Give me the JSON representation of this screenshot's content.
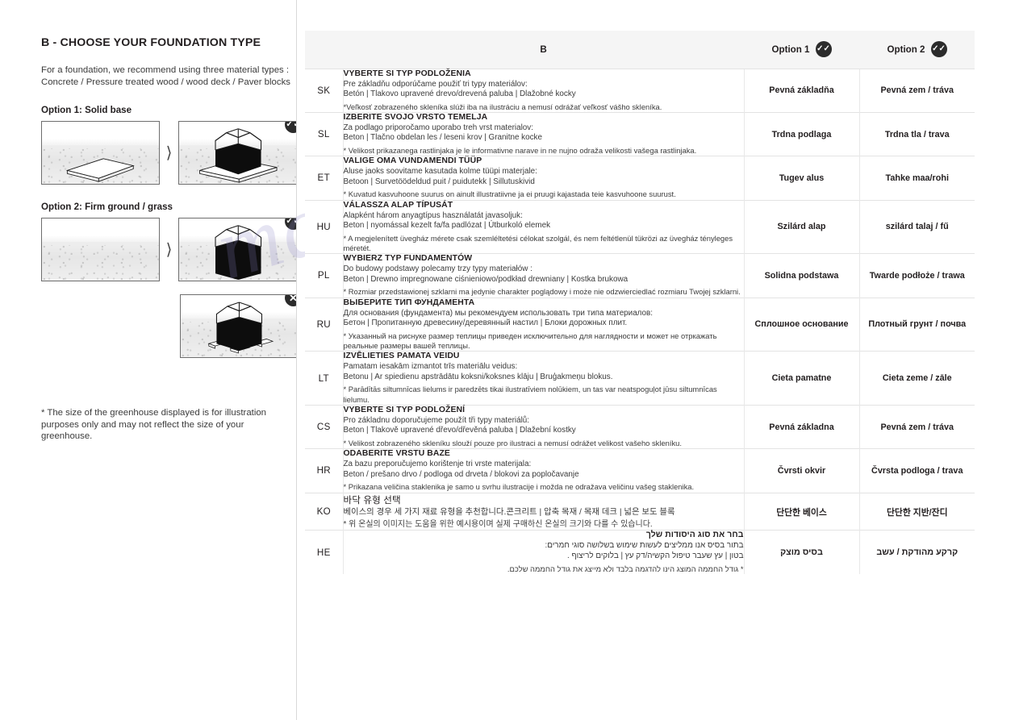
{
  "left": {
    "section_title": "B -  CHOOSE YOUR FOUNDATION TYPE",
    "intro_line1": "For a foundation, we recommend using three material types :",
    "intro_line2": "Concrete / Pressure treated wood / wood deck / Paver blocks",
    "option1_label": "Option 1: Solid base",
    "option2_label": "Option 2: Firm ground / grass",
    "arrow_glyph": "⟩",
    "badge_tick": "✓✓",
    "badge_cross": "✕",
    "footnote": "* The size of the greenhouse displayed is for illustration purposes only and may not reflect the size of your greenhouse."
  },
  "watermark": {
    "line1": "manualshive.com"
  },
  "table": {
    "header": {
      "lang": "",
      "body": "B",
      "option1": "Option 1",
      "option2": "Option 2",
      "badge": "✓✓"
    },
    "rows": [
      {
        "lang": "SK",
        "title": "VYBERTE SI TYP PODLOŽENIA",
        "line1": "Pre základňu odporúčame použiť tri typy materiálov:",
        "line2": "Betón | Tlakovo upravené drevo/drevená paluba | Dlažobné kocky",
        "note": "*Veľkosť zobrazeného skleníka slúži iba na ilustráciu a nemusí odrážať veľkosť vášho skleníka.",
        "option1": "Pevná základňa",
        "option2": "Pevná zem / tráva"
      },
      {
        "lang": "SL",
        "title": "IZBERITE SVOJO VRSTO TEMELJA",
        "line1": "Za podlago priporočamo uporabo treh vrst materialov:",
        "line2": "Beton |  Tlačno obdelan les / leseni krov  |  Granitne kocke",
        "note": "* Velikost prikazanega rastlinjaka je le informativne narave in ne nujno odraža velikosti vašega rastlinjaka.",
        "option1": "Trdna podlaga",
        "option2": "Trdna tla / trava"
      },
      {
        "lang": "ET",
        "title": "VALIGE OMA VUNDAMENDI TÜÜP",
        "line1": "Aluse jaoks soovitame kasutada kolme tüüpi materjale:",
        "line2": "Betoon | Survetöödeldud puit / puidutekk | Sillutuskivid",
        "note": "* Kuvatud kasvuhoone suurus on ainult illustratiivne ja ei pruugi kajastada teie kasvuhoone suurust.",
        "option1": "Tugev alus",
        "option2": "Tahke maa/rohi"
      },
      {
        "lang": "HU",
        "title": "VÁLASSZA ALAP TÍPUSÁT",
        "line1": "Alapként három anyagtípus használatát javasoljuk:",
        "line2": "Beton | nyomással kezelt fa/fa padlózat | Útburkoló elemek",
        "note": "* A megjelenített üvegház mérete csak szemléltetési célokat szolgál, és nem feltétlenül tükrözi az üvegház tényleges méretét.",
        "option1": "Szilárd alap",
        "option2": "szilárd talaj / fű"
      },
      {
        "lang": "PL",
        "title": "WYBIERZ TYP FUNDAMENTÓW",
        "line1": "Do budowy podstawy polecamy trzy typy materiałów :",
        "line2": "Beton |  Drewno impregnowane ciśnieniowo/podkład drewniany  |  Kostka brukowa",
        "note": "* Rozmiar przedstawionej szklarni ma jedynie charakter poglądowy i może nie odzwierciedlać rozmiaru Twojej szklarni.",
        "option1": "Solidna podstawa",
        "option2": "Twarde podłoże / trawa"
      },
      {
        "lang": "RU",
        "title": "ВЫБЕРИТЕ ТИП ФУНДАМЕНТА",
        "line1": "Для основания (фундамента) мы рекомендуем использовать три типа материалов:",
        "line2": "Бетон | Пропитанную древесину/деревянный настил | Блоки дорожных плит.",
        "note": "* Указанный на риснуке размер теплицы приведен исключительно для наглядности и может не отркажать реальные размеры вашей теплицы.",
        "option1": "Сплошное основание",
        "option2": "Плотный грунт / почва"
      },
      {
        "lang": "LT",
        "title": "IZVĒLIETIES PAMATA VEIDU",
        "line1": "Pamatam iesakām izmantot trīs materiālu veidus:",
        "line2": "Betonu | Ar spiedienu apstrādātu koksni/koksnes klāju | Bruģakmeņu blokus.",
        "note": "* Parādītās siltumnīcas lielums ir paredzēts tikai ilustratīviem nolūkiem, un tas var neatspoguļot jūsu siltumnīcas lielumu.",
        "option1": "Cieta pamatne",
        "option2": "Cieta zeme / zāle"
      },
      {
        "lang": "CS",
        "title": "VYBERTE SI TYP PODLOŽENÍ",
        "line1": "Pro základnu doporučujeme použít tři typy materiálů:",
        "line2": "Beton | Tlakově upravené dřevo/dřevěná paluba | Dlažební kostky",
        "note": "* Velikost zobrazeného skleníku slouží pouze pro ilustraci a nemusí odrážet velikost vašeho skleníku.",
        "option1": "Pevná základna",
        "option2": "Pevná zem / tráva"
      },
      {
        "lang": "HR",
        "title": "ODABERITE VRSTU BAZE",
        "line1": "Za bazu preporučujemo korištenje tri vrste materijala:",
        "line2": "Beton / prešano drvo / podloga od drveta / blokovi za popločavanje",
        "note": "* Prikazana veličina staklenika je samo u svrhu ilustracije i možda ne odražava veličinu vašeg staklenika.",
        "option1": "Čvrsti okvir",
        "option2": "Čvrsta podloga / trava"
      },
      {
        "lang": "KO",
        "title": "바닥 유형 선택",
        "line1": "베이스의 경우 세 가지 재료 유형을 추천합니다.콘크리트 | 압축 목재 / 목재 데크 | 넓은 보도 블록",
        "line2": "",
        "note": "* 위 온실의 이미지는 도움을 위한 예시용이며 실제 구매하신 온실의 크기와 다를 수 있습니다.",
        "option1": "단단한 베이스",
        "option2": "단단한 지반/잔디"
      },
      {
        "lang": "HE",
        "title": "בחר את סוג היסודות שלך",
        "line1": "בתור בסיס אנו ממליצים לעשות שימוש בשלושה סוגי חמרים:",
        "line2": "בטון | עץ שעבר טיפול הקשיה/דק עץ | בלוקים לריצוף .",
        "note": "* גודל החממה המוצג הינו להדגמה בלבד ולא מייצג את גודל החממה שלכם.",
        "option1": "בסיס מוצק",
        "option2": "קרקע מהודקת / עשב"
      }
    ]
  },
  "colors": {
    "badge_dark": "#2b2b2b",
    "lang_col_bg": "#ececec",
    "header_bg": "#f5f5f5",
    "text": "#231f20",
    "watermark": "#8d86c9"
  }
}
